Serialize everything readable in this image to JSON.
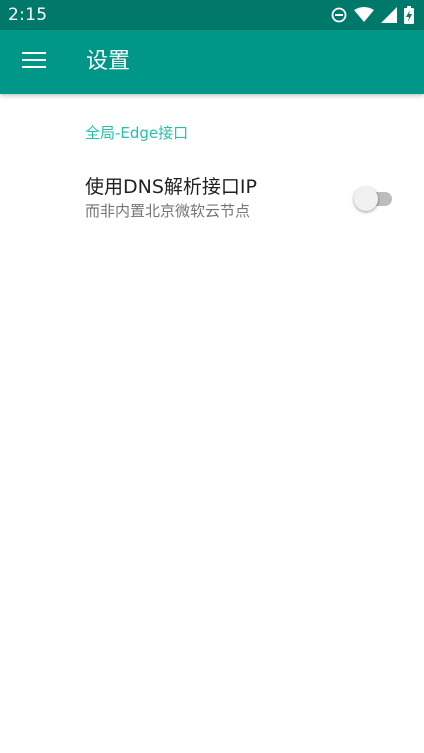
{
  "status_bar": {
    "time": "2:15",
    "icons": [
      "do-not-disturb-icon",
      "wifi-icon",
      "signal-icon",
      "battery-charging-icon"
    ]
  },
  "app_bar": {
    "menu_icon": "hamburger-menu-icon",
    "title": "设置"
  },
  "settings": {
    "category_title": "全局-Edge接口",
    "items": [
      {
        "title": "使用DNS解析接口IP",
        "summary": "而非内置北京微软云节点",
        "switch_on": false
      }
    ]
  },
  "colors": {
    "status_bar": "#00796b",
    "app_bar": "#009688",
    "accent": "#26bfaa",
    "primary_text": "#212121",
    "secondary_text": "#757575",
    "switch_track_off": "#bdbdbd",
    "switch_thumb_off": "#f1f1f1"
  }
}
